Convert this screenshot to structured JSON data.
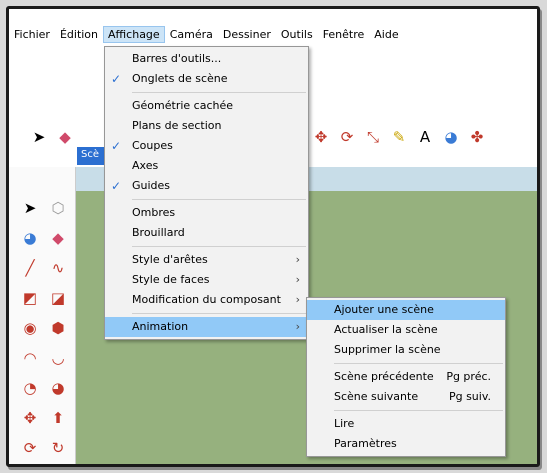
{
  "menubar": {
    "items": [
      "Fichier",
      "Édition",
      "Affichage",
      "Caméra",
      "Dessiner",
      "Outils",
      "Fenêtre",
      "Aide"
    ],
    "active_index": 2
  },
  "scene_tab": "Scè",
  "view_menu": {
    "groups": [
      [
        {
          "label": "Barres d'outils...",
          "checked": false,
          "submenu": false
        },
        {
          "label": "Onglets de scène",
          "checked": true,
          "submenu": false
        }
      ],
      [
        {
          "label": "Géométrie cachée",
          "checked": false,
          "submenu": false
        },
        {
          "label": "Plans de section",
          "checked": false,
          "submenu": false
        },
        {
          "label": "Coupes",
          "checked": true,
          "submenu": false
        },
        {
          "label": "Axes",
          "checked": false,
          "submenu": false
        },
        {
          "label": "Guides",
          "checked": true,
          "submenu": false
        }
      ],
      [
        {
          "label": "Ombres",
          "checked": false,
          "submenu": false
        },
        {
          "label": "Brouillard",
          "checked": false,
          "submenu": false
        }
      ],
      [
        {
          "label": "Style d'arêtes",
          "checked": false,
          "submenu": true
        },
        {
          "label": "Style de faces",
          "checked": false,
          "submenu": true
        },
        {
          "label": "Modification du composant",
          "checked": false,
          "submenu": true
        }
      ],
      [
        {
          "label": "Animation",
          "checked": false,
          "submenu": true,
          "highlight": true
        }
      ]
    ]
  },
  "animation_menu": {
    "groups": [
      [
        {
          "label": "Ajouter une scène",
          "shortcut": "",
          "highlight": true
        },
        {
          "label": "Actualiser la scène",
          "shortcut": ""
        },
        {
          "label": "Supprimer la scène",
          "shortcut": ""
        }
      ],
      [
        {
          "label": "Scène précédente",
          "shortcut": "Pg préc."
        },
        {
          "label": "Scène suivante",
          "shortcut": "Pg suiv."
        }
      ],
      [
        {
          "label": "Lire",
          "shortcut": ""
        },
        {
          "label": "Paramètres",
          "shortcut": ""
        }
      ]
    ]
  },
  "colors": {
    "highlight": "#91c9f7",
    "check": "#2b6fd1",
    "ground": "#96b17e",
    "sky": "#c8dde8"
  }
}
